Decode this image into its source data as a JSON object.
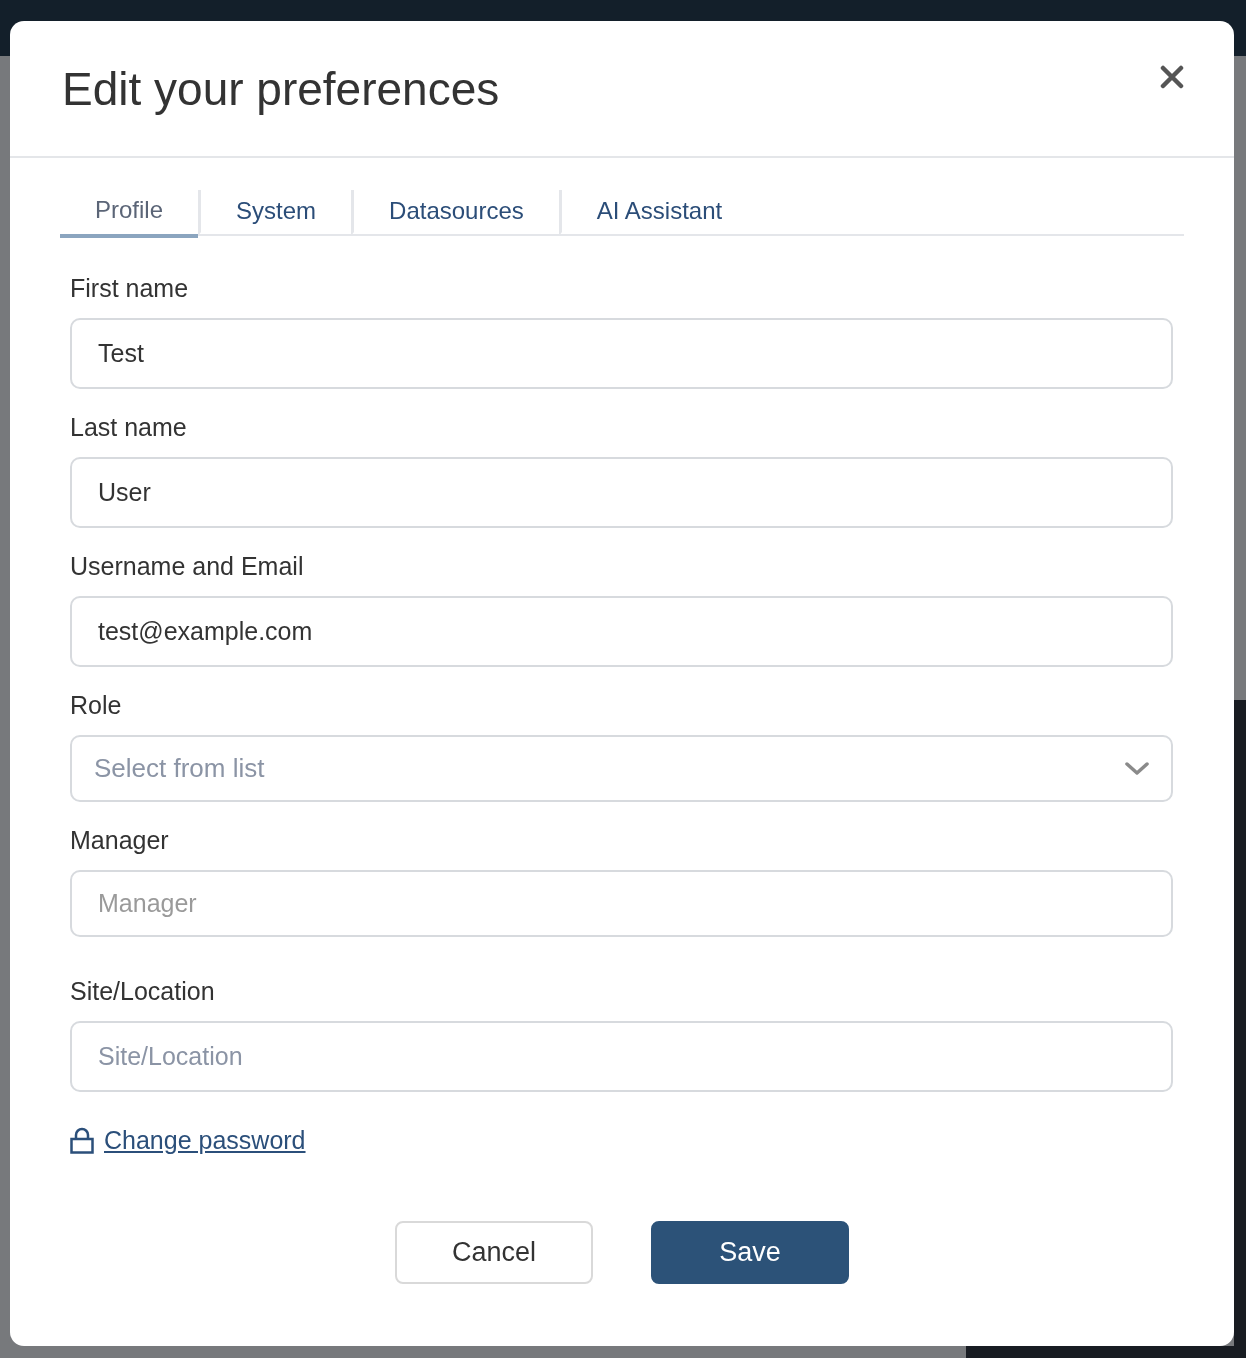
{
  "dialog": {
    "title": "Edit your preferences"
  },
  "tabs": [
    {
      "label": "Profile",
      "selected": true
    },
    {
      "label": "System",
      "selected": false
    },
    {
      "label": "Datasources",
      "selected": false
    },
    {
      "label": "AI Assistant",
      "selected": false
    }
  ],
  "fields": [
    {
      "kind": "text",
      "label": "First name",
      "value": "Test"
    },
    {
      "kind": "text",
      "label": "Last name",
      "value": "User"
    },
    {
      "kind": "text",
      "label": "Username and Email",
      "value": "test@example.com"
    },
    {
      "kind": "select",
      "label": "Role",
      "placeholder": "Select from list"
    },
    {
      "kind": "lookup",
      "label": "Manager",
      "placeholder": "Manager"
    },
    {
      "kind": "text",
      "label": "Site/Location",
      "placeholder": "Site/Location"
    }
  ],
  "password_link": {
    "label": "Change password"
  },
  "buttons": [
    {
      "kind": "secondary",
      "label": "Cancel"
    },
    {
      "kind": "primary",
      "label": "Save"
    }
  ]
}
